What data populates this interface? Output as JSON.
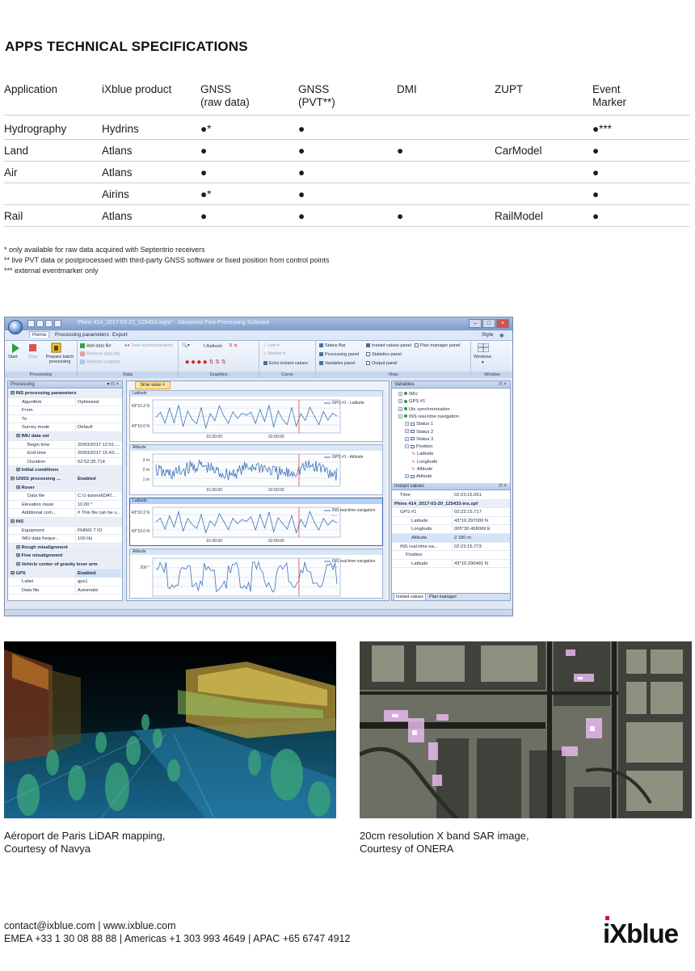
{
  "heading": "APPS TECHNICAL SPECIFICATIONS",
  "spec_table": {
    "headers": [
      [
        "Application"
      ],
      [
        "iXblue product"
      ],
      [
        "GNSS",
        "(raw data)"
      ],
      [
        "GNSS",
        "(PVT**)"
      ],
      [
        "DMI"
      ],
      [
        "ZUPT"
      ],
      [
        "Event",
        "Marker"
      ]
    ],
    "rows": [
      [
        "Hydrography",
        "Hydrins",
        "●*",
        "●",
        "",
        "",
        "●***"
      ],
      [
        "Land",
        "Atlans",
        "●",
        "●",
        "●",
        "CarModel",
        "●"
      ],
      [
        "Air",
        "Atlans",
        "●",
        "●",
        "",
        "",
        "●"
      ],
      [
        "",
        "Airins",
        "●*",
        "●",
        "",
        "",
        "●"
      ],
      [
        "Rail",
        "Atlans",
        "●",
        "●",
        "●",
        "RailModel",
        "●"
      ]
    ]
  },
  "footnotes": [
    "* only available for raw data acquired with Septentrio receivers",
    "** live PVT data or postprocessed with third-party GNSS software or fixed position from control points",
    "*** external eventmarker only"
  ],
  "software": {
    "title": "Phins 414_2017-03-20_125433.ixgrp* - Advanced Post-Processing Software",
    "menu": [
      "Home",
      "Processing parameters",
      "Export"
    ],
    "style_label": "Style",
    "ribbon": {
      "processing": {
        "start": "Start",
        "stop": "Stop",
        "prepare": "Prepare batch processing",
        "label": "Processing"
      },
      "data": {
        "add": "Add data file",
        "remove": "Remove data file",
        "refresh": "Refresh contents",
        "label": "Data"
      },
      "graphics": {
        "timesync": "Time synchronization",
        "refresh": "Refresh",
        "label": "Graphics"
      },
      "curve": {
        "line": "Line",
        "marker": "Marker",
        "echo": "Echo instant values",
        "label": "Curve"
      },
      "view": {
        "status_bar": "Status Bar",
        "processing_panel": "Processing panel",
        "variables_panel": "Variables panel",
        "instant_values_panel": "Instant values panel",
        "statistics_panel": "Statistics panel",
        "output_panel": "Output panel",
        "plan_manager_panel": "Plan manager panel",
        "label": "View"
      },
      "window": {
        "windows": "Windows",
        "label": "Window"
      }
    },
    "processing_panel": {
      "title": "Processing",
      "rows": [
        {
          "k": "INS processing parameters",
          "v": "",
          "sec": true,
          "ind": 0
        },
        {
          "k": "Algorithm",
          "v": "Optimized",
          "ind": 2
        },
        {
          "k": "From",
          "v": "",
          "ind": 2
        },
        {
          "k": "To",
          "v": "",
          "ind": 2
        },
        {
          "k": "Survey mode",
          "v": "Default",
          "ind": 2
        },
        {
          "k": "IMU data set",
          "v": "",
          "sec": true,
          "ind": 1
        },
        {
          "k": "Begin time",
          "v": "20/03/2017 12:51:...",
          "ind": 3
        },
        {
          "k": "End time",
          "v": "20/03/2017 15:43:...",
          "ind": 3
        },
        {
          "k": "Duration",
          "v": "02:52:35.714",
          "ind": 3
        },
        {
          "k": "Initial conditions",
          "v": "",
          "sec": true,
          "ind": 1
        },
        {
          "k": "GNSS processing ...",
          "v": "Enabled",
          "sec": true,
          "ind": 0
        },
        {
          "k": "Rover",
          "v": "",
          "sec": true,
          "ind": 1
        },
        {
          "k": "Data file",
          "v": "C:\\1-tutorial\\DAT...",
          "ind": 3
        },
        {
          "k": "Elevation mask",
          "v": "10.00 °",
          "ind": 2
        },
        {
          "k": "Additional com...",
          "v": "# This file can be u...",
          "ind": 2
        },
        {
          "k": "INS",
          "v": "",
          "sec": true,
          "ind": 0
        },
        {
          "k": "Equipment",
          "v": "PHINS 7 IO",
          "ind": 2
        },
        {
          "k": "IMU data freque...",
          "v": "100 Hz",
          "ind": 2
        },
        {
          "k": "Rough misalignment",
          "v": "",
          "sec": true,
          "ind": 1
        },
        {
          "k": "Fine misalignment",
          "v": "",
          "sec": true,
          "ind": 1
        },
        {
          "k": "Vehicle center of gravity lever arm",
          "v": "",
          "sec": true,
          "ind": 1
        },
        {
          "k": "GPS",
          "v": "Enabled",
          "sec": true,
          "ind": 0,
          "hl": true
        },
        {
          "k": "Label",
          "v": "gps1",
          "ind": 2
        },
        {
          "k": "Data file",
          "v": "Automatic",
          "ind": 2
        }
      ]
    },
    "time_view": {
      "tab": "time view",
      "charts": [
        {
          "title": "Latitude",
          "y_ticks": [
            "43°10.2 N",
            "43°10.0 N"
          ],
          "x_ticks": [
            "01:00:00",
            "02:00:00"
          ],
          "legend": "GPS #1 - Latitude"
        },
        {
          "title": "Altitude",
          "y_ticks": [
            "3 m",
            "2 m",
            "1 m"
          ],
          "x_ticks": [
            "01:00:00",
            "02:00:00"
          ],
          "legend": "GPS #1 - Altitude"
        },
        {
          "title": "Latitude",
          "y_ticks": [
            "43°10.2 N",
            "43°10.0 N"
          ],
          "x_ticks": [
            "01:00:00",
            "02:00:00"
          ],
          "legend": "INS real-time navigation -..."
        },
        {
          "title": "Altitude",
          "y_ticks": [
            "200 °"
          ],
          "x_ticks": [],
          "legend": "INS real-time navigation -..."
        }
      ]
    },
    "variables_panel": {
      "title": "Variables",
      "nodes": [
        {
          "label": "IMU",
          "kind": "dot",
          "ind": 0
        },
        {
          "label": "GPS #1",
          "kind": "dot",
          "ind": 0
        },
        {
          "label": "Utc synchronization",
          "kind": "dot",
          "ind": 0
        },
        {
          "label": "INS real-time navigation",
          "kind": "dot",
          "ind": 0
        },
        {
          "label": "Status 1",
          "kind": "fld",
          "ind": 1
        },
        {
          "label": "Status 2",
          "kind": "fld",
          "ind": 1
        },
        {
          "label": "Status 3",
          "kind": "fld",
          "ind": 1
        },
        {
          "label": "Position",
          "kind": "fld",
          "ind": 1
        },
        {
          "label": "Latitude",
          "kind": "wave",
          "ind": 2
        },
        {
          "label": "Longitude",
          "kind": "wave",
          "ind": 2
        },
        {
          "label": "Altitude",
          "kind": "wave",
          "ind": 2
        },
        {
          "label": "Attitude",
          "kind": "fld",
          "ind": 1
        }
      ]
    },
    "instant_values": {
      "title": "Instant values",
      "rows": [
        {
          "k": "Time",
          "v": "02:23:16.051",
          "ind": 1
        },
        {
          "k": "Phins 414_2017-03-20_125433-ins.xpf",
          "v": "",
          "sec": true,
          "ind": 0
        },
        {
          "k": "GPS #1",
          "v": "02:23:15.717",
          "ind": 1
        },
        {
          "k": "Latitude",
          "v": "43°10.297000 N",
          "ind": 3
        },
        {
          "k": "Longitude",
          "v": "005°36.458069 E",
          "ind": 3
        },
        {
          "k": "Altitude",
          "v": "2.180 m",
          "ind": 3,
          "hl": true
        },
        {
          "k": "INS real-time na...",
          "v": "02:23:15.773",
          "ind": 1
        },
        {
          "k": "Position",
          "v": "",
          "ind": 2
        },
        {
          "k": "Latitude",
          "v": "43°10.296481 N",
          "ind": 3
        }
      ],
      "tabs": [
        "Instant values",
        "Plan manager"
      ]
    }
  },
  "captions": {
    "lidar": [
      "Aéroport de Paris LiDAR mapping,",
      "Courtesy of Navya"
    ],
    "sar": [
      "20cm resolution X band SAR image,",
      "Courtesy of ONERA"
    ]
  },
  "footer": {
    "line1": "contact@ixblue.com | www.ixblue.com",
    "line2": "EMEA +33 1 30 08 88 88 | Americas +1 303 993 4649 | APAC +65 6747 4912"
  },
  "logo_text": "iXblue"
}
